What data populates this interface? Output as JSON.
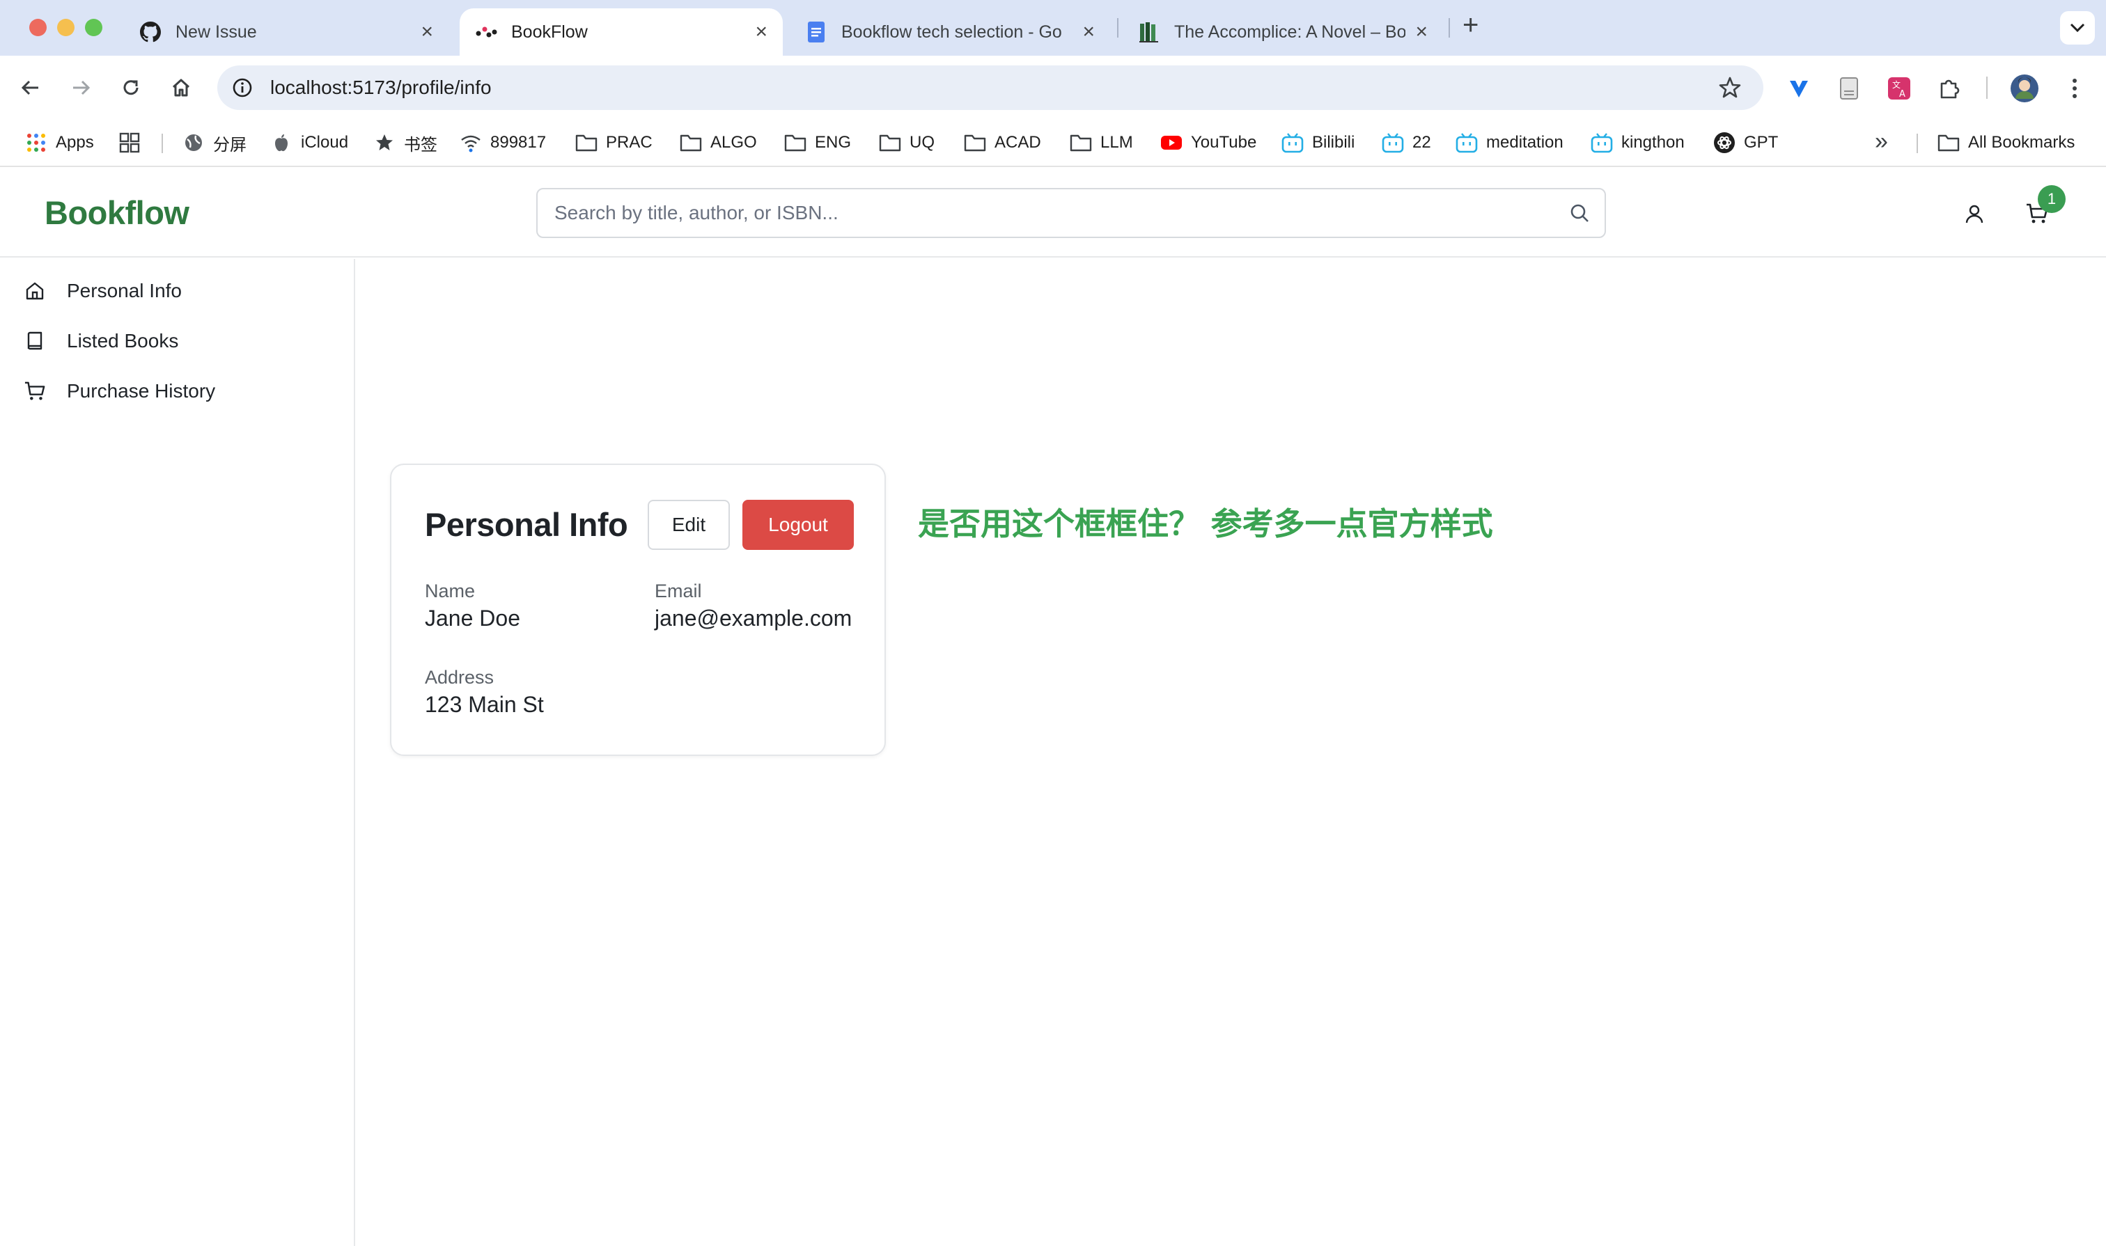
{
  "browser": {
    "tabs": [
      {
        "title": "New Issue",
        "icon": "github-icon"
      },
      {
        "title": "BookFlow",
        "icon": "bookflow-favicon",
        "active": true
      },
      {
        "title": "Bookflow tech selection - Go",
        "icon": "google-docs-icon"
      },
      {
        "title": "The Accomplice: A Novel – Bo",
        "icon": "books-favicon"
      }
    ],
    "new_tab_symbol": "+",
    "url": "localhost:5173/profile/info",
    "bookmarks": [
      {
        "label": "Apps",
        "icon": "apps-grid-icon"
      },
      {
        "label": "",
        "icon": "tab-groups-icon"
      },
      {
        "label": "分屏",
        "icon": "globe-icon"
      },
      {
        "label": "iCloud",
        "icon": "apple-icon"
      },
      {
        "label": "书签",
        "icon": "star-icon"
      },
      {
        "label": "899817",
        "icon": "wifi-icon"
      },
      {
        "label": "PRAC",
        "icon": "folder-icon"
      },
      {
        "label": "ALGO",
        "icon": "folder-icon"
      },
      {
        "label": "ENG",
        "icon": "folder-icon"
      },
      {
        "label": "UQ",
        "icon": "folder-icon"
      },
      {
        "label": "ACAD",
        "icon": "folder-icon"
      },
      {
        "label": "LLM",
        "icon": "folder-icon"
      },
      {
        "label": "YouTube",
        "icon": "youtube-icon"
      },
      {
        "label": "Bilibili",
        "icon": "bilibili-icon"
      },
      {
        "label": "22",
        "icon": "bilibili-icon"
      },
      {
        "label": "meditation",
        "icon": "bilibili-icon"
      },
      {
        "label": "kingthon",
        "icon": "bilibili-icon"
      },
      {
        "label": "GPT",
        "icon": "openai-icon"
      }
    ],
    "overflow_symbol": "»",
    "all_bookmarks_label": "All Bookmarks"
  },
  "app": {
    "brand": "Bookflow",
    "search_placeholder": "Search by title, author, or ISBN...",
    "cart_count": "1",
    "sidebar": [
      {
        "label": "Personal Info",
        "icon": "home-icon"
      },
      {
        "label": "Listed Books",
        "icon": "book-icon"
      },
      {
        "label": "Purchase History",
        "icon": "cart-icon"
      }
    ],
    "card": {
      "title": "Personal Info",
      "edit_label": "Edit",
      "logout_label": "Logout",
      "fields": [
        {
          "label": "Name",
          "value": "Jane Doe"
        },
        {
          "label": "Email",
          "value": "jane@example.com"
        },
        {
          "label": "Address",
          "value": "123 Main St"
        }
      ]
    },
    "annotation": "是否用这个框框住？ 参考多一点官方样式"
  },
  "colors": {
    "brand": "#2f7a40",
    "logout": "#dc4a45",
    "badge": "#3a9d52",
    "annotation": "#3aa352",
    "tabstrip": "#dbe4f6"
  }
}
